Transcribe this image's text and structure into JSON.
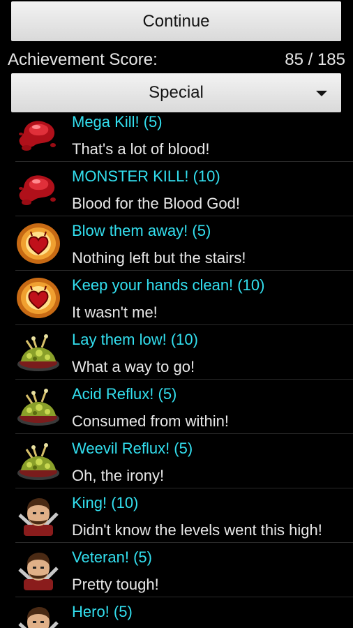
{
  "header": {
    "continue_label": "Continue",
    "score_label": "Achievement Score:",
    "score_value": "85 / 185",
    "filter_selected": "Special"
  },
  "achievements": [
    {
      "title": "Mega Kill! (5)",
      "desc": "That's a lot of blood!",
      "icon": "blood-splatter-icon"
    },
    {
      "title": "MONSTER KILL! (10)",
      "desc": "Blood for the Blood God!",
      "icon": "blood-splatter-icon"
    },
    {
      "title": "Blow them away! (5)",
      "desc": "Nothing left but the stairs!",
      "icon": "fire-heart-icon"
    },
    {
      "title": "Keep your hands clean! (10)",
      "desc": "It wasn't me!",
      "icon": "fire-heart-icon"
    },
    {
      "title": "Lay them low! (10)",
      "desc": "What a way to go!",
      "icon": "acid-pile-icon"
    },
    {
      "title": "Acid Reflux! (5)",
      "desc": "Consumed from within!",
      "icon": "acid-pile-icon"
    },
    {
      "title": "Weevil Reflux! (5)",
      "desc": "Oh, the irony!",
      "icon": "acid-pile-icon"
    },
    {
      "title": "King! (10)",
      "desc": "Didn't know the levels went this high!",
      "icon": "warrior-icon"
    },
    {
      "title": "Veteran! (5)",
      "desc": "Pretty tough!",
      "icon": "warrior-icon"
    },
    {
      "title": "Hero! (5)",
      "desc": "",
      "icon": "warrior-icon"
    }
  ]
}
